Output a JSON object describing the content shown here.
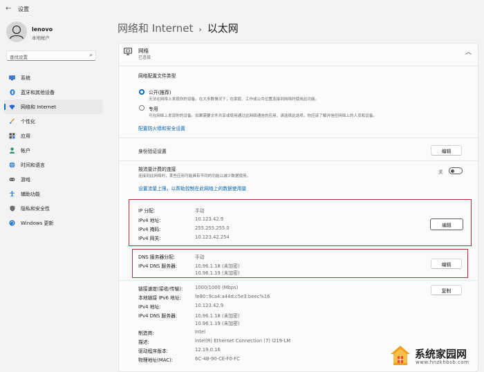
{
  "window": {
    "title": "设置"
  },
  "user": {
    "name": "lenovo",
    "account": "本地帐户"
  },
  "search": {
    "placeholder": "查找设置"
  },
  "nav": {
    "items": [
      {
        "label": "系统",
        "icon": "monitor-icon"
      },
      {
        "label": "蓝牙和其他设备",
        "icon": "bluetooth-icon"
      },
      {
        "label": "网络和 Internet",
        "icon": "wifi-icon",
        "active": true
      },
      {
        "label": "个性化",
        "icon": "brush-icon"
      },
      {
        "label": "应用",
        "icon": "apps-icon"
      },
      {
        "label": "帐户",
        "icon": "person-icon"
      },
      {
        "label": "时间和语言",
        "icon": "globe-icon"
      },
      {
        "label": "游戏",
        "icon": "gamepad-icon"
      },
      {
        "label": "辅助功能",
        "icon": "accessibility-icon"
      },
      {
        "label": "隐私和安全性",
        "icon": "shield-icon"
      },
      {
        "label": "Windows 更新",
        "icon": "update-icon"
      }
    ]
  },
  "breadcrumb": {
    "parent": "网络和 Internet",
    "separator": "›",
    "current": "以太网"
  },
  "network": {
    "title": "网络",
    "status": "已连接",
    "profile_heading": "网络配置文件类型",
    "public_label": "公开(推荐)",
    "public_desc": "无法在网络上发现你的设备。在大多数情况下，在家庭、工作或公共位置连接到网络时使用此功能。",
    "private_label": "专用",
    "private_desc": "可在网络上发现你的设备。如果需要文件共享或使用通过此网络通信的应用，请选择此选项。你应该了解并信任网络上的人员和设备。",
    "firewall_link": "配置防火墙和安全设置"
  },
  "auth": {
    "label": "身份验证设置",
    "button": "编辑"
  },
  "metered": {
    "label": "按流量计费的连接",
    "desc": "连接到此网络时，某些应用可能具有不同的功能以减少数据使用。",
    "toggle_text": "关",
    "link": "设置流量上限，以帮助控制在此网络上的数据使用量"
  },
  "ip": {
    "rows": [
      {
        "label": "IP 分配:",
        "value": "手动"
      },
      {
        "label": "IPv4 地址:",
        "value": "10.123.42.9"
      },
      {
        "label": "IPv4 掩码:",
        "value": "255.255.255.0"
      },
      {
        "label": "IPv4 网关:",
        "value": "10.123.42.254"
      }
    ],
    "button": "编辑"
  },
  "dns": {
    "assign_label": "DNS 服务器分配:",
    "assign_value": "手动",
    "servers_label": "IPv4 DNS 服务器:",
    "server1": "10.96.1.18 (未加密)",
    "server2": "10.96.1.19 (未加密)",
    "button": "编辑"
  },
  "props": {
    "copy_button": "复制",
    "rows": [
      {
        "label": "链接速度(接收/传输):",
        "value": "1000/1000 (Mbps)"
      },
      {
        "label": "本地链接 IPv6 地址:",
        "value": "fe80::9ca4:a44d:c5e3:beec%16"
      },
      {
        "label": "IPv4 地址:",
        "value": "10.123.42.9"
      },
      {
        "label": "IPv4 DNS 服务器:",
        "value": "10.96.1.18 (未加密)",
        "value2": "10.96.1.19 (未加密)"
      },
      {
        "label": "制造商:",
        "value": "Intel"
      },
      {
        "label": "描述:",
        "value": "Intel(R) Ethernet Connection (7) I219-LM"
      },
      {
        "label": "驱动程序版本:",
        "value": "12.19.0.16"
      },
      {
        "label": "物理地址(MAC):",
        "value": "6C-4B-90-CE-F0-FC"
      }
    ]
  },
  "watermark": {
    "title": "系统家园网",
    "url": "www.hnzkhbsb.com"
  },
  "colors": {
    "accent": "#0067c0",
    "highlight_border": "#b2333a",
    "link": "#0061b0"
  }
}
